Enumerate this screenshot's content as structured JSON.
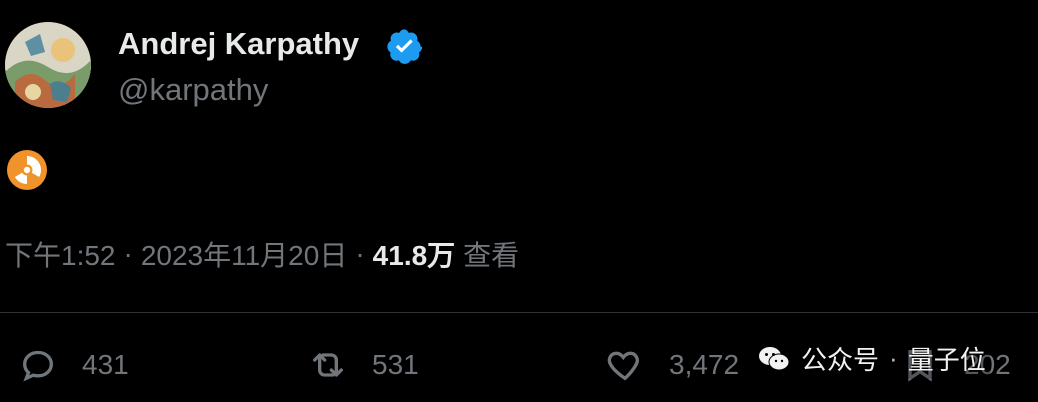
{
  "author": {
    "display_name": "Andrej Karpathy",
    "handle": "@karpathy",
    "verified_badge_icon": "verified-check-icon",
    "verified_color": "#1d9bf0"
  },
  "tweet": {
    "content_emoji": "☢",
    "content_emoji_name": "radioactive-icon"
  },
  "meta": {
    "time": "下午1:52",
    "separator": "·",
    "date": "2023年11月20日",
    "views_count": "41.8万",
    "views_label": "查看"
  },
  "actions": {
    "reply_count": "431",
    "retweet_count": "531",
    "like_count": "3,472",
    "bookmark_count": "202"
  },
  "watermark": {
    "platform": "公众号",
    "separator": "·",
    "account": "量子位"
  },
  "colors": {
    "background": "#000000",
    "text_primary": "#e7e9ea",
    "text_secondary": "#71767b",
    "divider": "#2f3336",
    "emoji_orange": "#f0932b"
  }
}
